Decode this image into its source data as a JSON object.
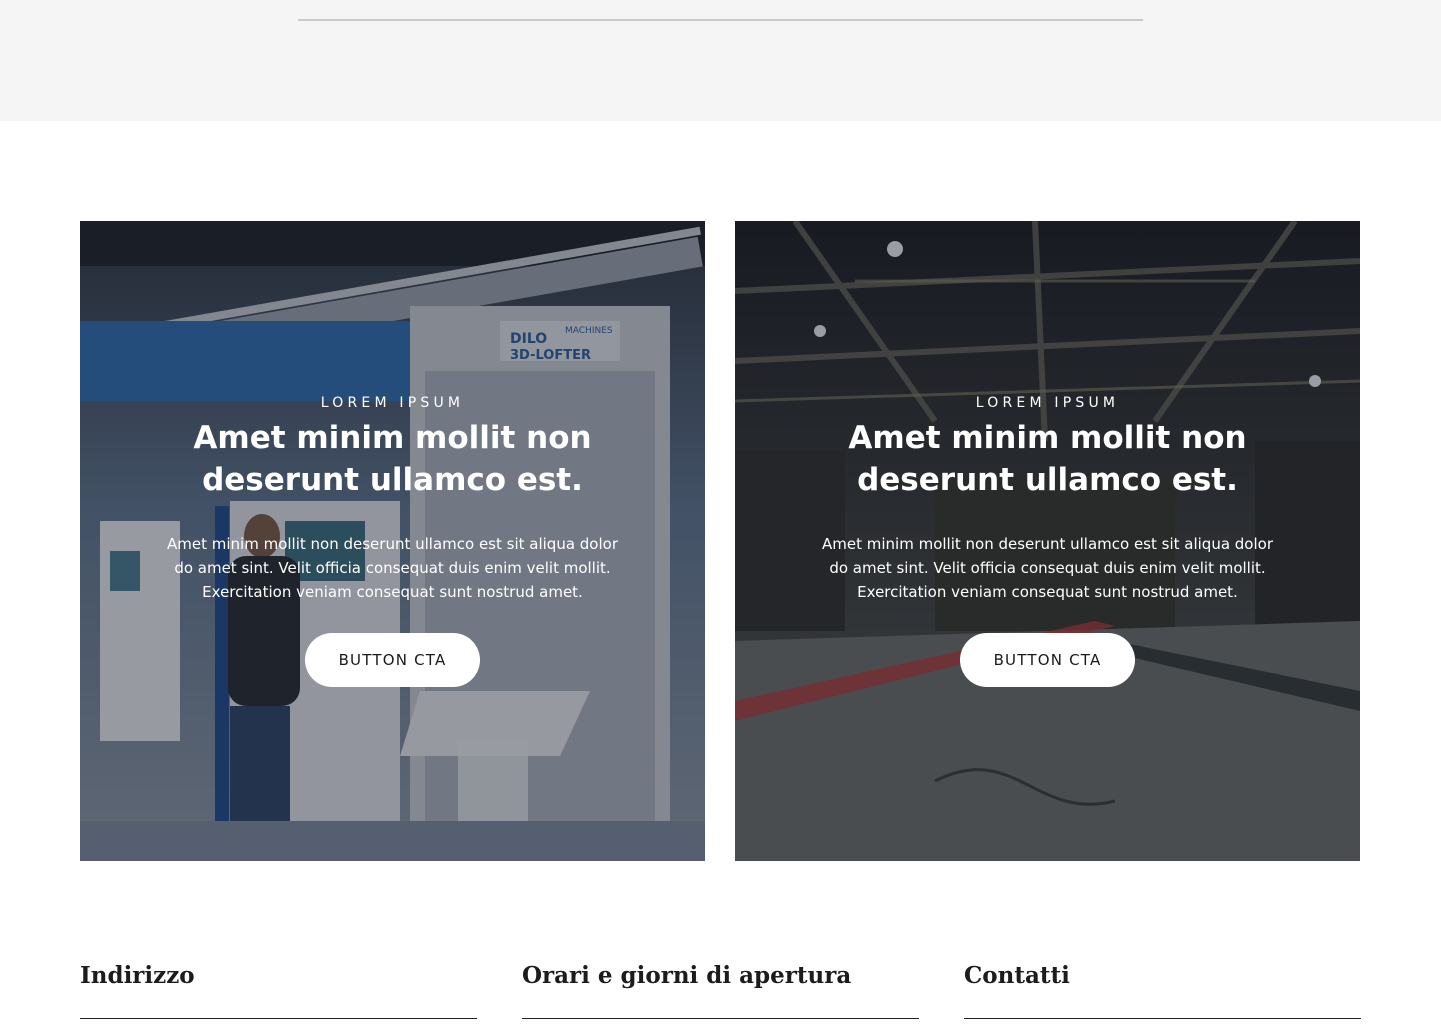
{
  "cards": [
    {
      "eyebrow": "LOREM IPSUM",
      "headline": "Amet minim mollit non deserunt ullamco est.",
      "body": "Amet minim mollit non deserunt ullamco est sit aliqua dolor do amet sint. Velit officia consequat duis enim velit mollit. Exercitation veniam consequat sunt nostrud amet.",
      "cta_label": "BUTTON CTA",
      "image_text_1": "DILO",
      "image_text_2": "MACHINES",
      "image_text_3": "3D-LOFTER"
    },
    {
      "eyebrow": "LOREM IPSUM",
      "headline": "Amet minim mollit non deserunt ullamco est.",
      "body": "Amet minim mollit non deserunt ullamco est sit aliqua dolor do amet sint. Velit officia consequat duis enim velit mollit. Exercitation veniam consequat sunt nostrud amet.",
      "cta_label": "BUTTON CTA"
    }
  ],
  "footer": {
    "address_title": "Indirizzo",
    "hours_title": "Orari e giorni di apertura",
    "contacts_title": "Contatti"
  },
  "colors": {
    "top_band": "#f5f5f5",
    "overlay": "rgba(20,24,34,0.38)",
    "cta_bg": "#ffffff"
  }
}
